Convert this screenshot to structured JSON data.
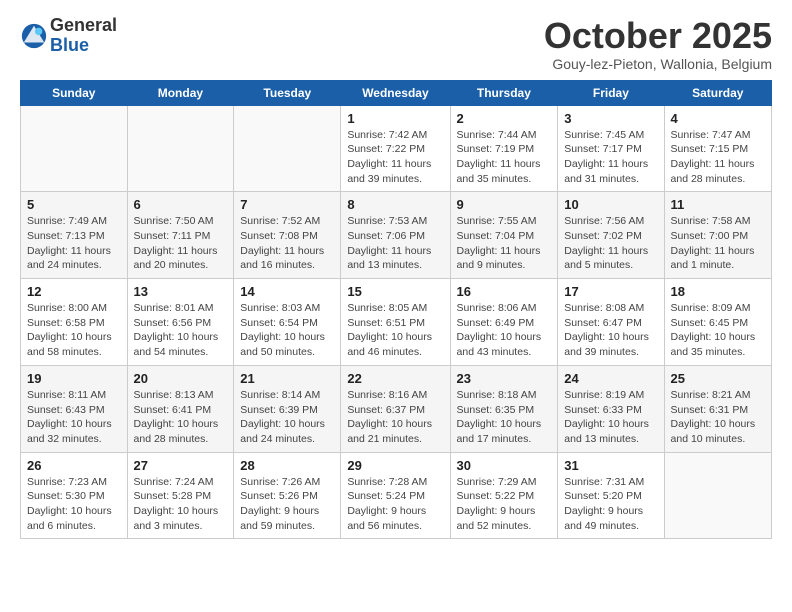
{
  "logo": {
    "general": "General",
    "blue": "Blue"
  },
  "header": {
    "month": "October 2025",
    "location": "Gouy-lez-Pieton, Wallonia, Belgium"
  },
  "weekdays": [
    "Sunday",
    "Monday",
    "Tuesday",
    "Wednesday",
    "Thursday",
    "Friday",
    "Saturday"
  ],
  "weeks": [
    [
      {
        "day": "",
        "info": ""
      },
      {
        "day": "",
        "info": ""
      },
      {
        "day": "",
        "info": ""
      },
      {
        "day": "1",
        "info": "Sunrise: 7:42 AM\nSunset: 7:22 PM\nDaylight: 11 hours and 39 minutes."
      },
      {
        "day": "2",
        "info": "Sunrise: 7:44 AM\nSunset: 7:19 PM\nDaylight: 11 hours and 35 minutes."
      },
      {
        "day": "3",
        "info": "Sunrise: 7:45 AM\nSunset: 7:17 PM\nDaylight: 11 hours and 31 minutes."
      },
      {
        "day": "4",
        "info": "Sunrise: 7:47 AM\nSunset: 7:15 PM\nDaylight: 11 hours and 28 minutes."
      }
    ],
    [
      {
        "day": "5",
        "info": "Sunrise: 7:49 AM\nSunset: 7:13 PM\nDaylight: 11 hours and 24 minutes."
      },
      {
        "day": "6",
        "info": "Sunrise: 7:50 AM\nSunset: 7:11 PM\nDaylight: 11 hours and 20 minutes."
      },
      {
        "day": "7",
        "info": "Sunrise: 7:52 AM\nSunset: 7:08 PM\nDaylight: 11 hours and 16 minutes."
      },
      {
        "day": "8",
        "info": "Sunrise: 7:53 AM\nSunset: 7:06 PM\nDaylight: 11 hours and 13 minutes."
      },
      {
        "day": "9",
        "info": "Sunrise: 7:55 AM\nSunset: 7:04 PM\nDaylight: 11 hours and 9 minutes."
      },
      {
        "day": "10",
        "info": "Sunrise: 7:56 AM\nSunset: 7:02 PM\nDaylight: 11 hours and 5 minutes."
      },
      {
        "day": "11",
        "info": "Sunrise: 7:58 AM\nSunset: 7:00 PM\nDaylight: 11 hours and 1 minute."
      }
    ],
    [
      {
        "day": "12",
        "info": "Sunrise: 8:00 AM\nSunset: 6:58 PM\nDaylight: 10 hours and 58 minutes."
      },
      {
        "day": "13",
        "info": "Sunrise: 8:01 AM\nSunset: 6:56 PM\nDaylight: 10 hours and 54 minutes."
      },
      {
        "day": "14",
        "info": "Sunrise: 8:03 AM\nSunset: 6:54 PM\nDaylight: 10 hours and 50 minutes."
      },
      {
        "day": "15",
        "info": "Sunrise: 8:05 AM\nSunset: 6:51 PM\nDaylight: 10 hours and 46 minutes."
      },
      {
        "day": "16",
        "info": "Sunrise: 8:06 AM\nSunset: 6:49 PM\nDaylight: 10 hours and 43 minutes."
      },
      {
        "day": "17",
        "info": "Sunrise: 8:08 AM\nSunset: 6:47 PM\nDaylight: 10 hours and 39 minutes."
      },
      {
        "day": "18",
        "info": "Sunrise: 8:09 AM\nSunset: 6:45 PM\nDaylight: 10 hours and 35 minutes."
      }
    ],
    [
      {
        "day": "19",
        "info": "Sunrise: 8:11 AM\nSunset: 6:43 PM\nDaylight: 10 hours and 32 minutes."
      },
      {
        "day": "20",
        "info": "Sunrise: 8:13 AM\nSunset: 6:41 PM\nDaylight: 10 hours and 28 minutes."
      },
      {
        "day": "21",
        "info": "Sunrise: 8:14 AM\nSunset: 6:39 PM\nDaylight: 10 hours and 24 minutes."
      },
      {
        "day": "22",
        "info": "Sunrise: 8:16 AM\nSunset: 6:37 PM\nDaylight: 10 hours and 21 minutes."
      },
      {
        "day": "23",
        "info": "Sunrise: 8:18 AM\nSunset: 6:35 PM\nDaylight: 10 hours and 17 minutes."
      },
      {
        "day": "24",
        "info": "Sunrise: 8:19 AM\nSunset: 6:33 PM\nDaylight: 10 hours and 13 minutes."
      },
      {
        "day": "25",
        "info": "Sunrise: 8:21 AM\nSunset: 6:31 PM\nDaylight: 10 hours and 10 minutes."
      }
    ],
    [
      {
        "day": "26",
        "info": "Sunrise: 7:23 AM\nSunset: 5:30 PM\nDaylight: 10 hours and 6 minutes."
      },
      {
        "day": "27",
        "info": "Sunrise: 7:24 AM\nSunset: 5:28 PM\nDaylight: 10 hours and 3 minutes."
      },
      {
        "day": "28",
        "info": "Sunrise: 7:26 AM\nSunset: 5:26 PM\nDaylight: 9 hours and 59 minutes."
      },
      {
        "day": "29",
        "info": "Sunrise: 7:28 AM\nSunset: 5:24 PM\nDaylight: 9 hours and 56 minutes."
      },
      {
        "day": "30",
        "info": "Sunrise: 7:29 AM\nSunset: 5:22 PM\nDaylight: 9 hours and 52 minutes."
      },
      {
        "day": "31",
        "info": "Sunrise: 7:31 AM\nSunset: 5:20 PM\nDaylight: 9 hours and 49 minutes."
      },
      {
        "day": "",
        "info": ""
      }
    ]
  ]
}
